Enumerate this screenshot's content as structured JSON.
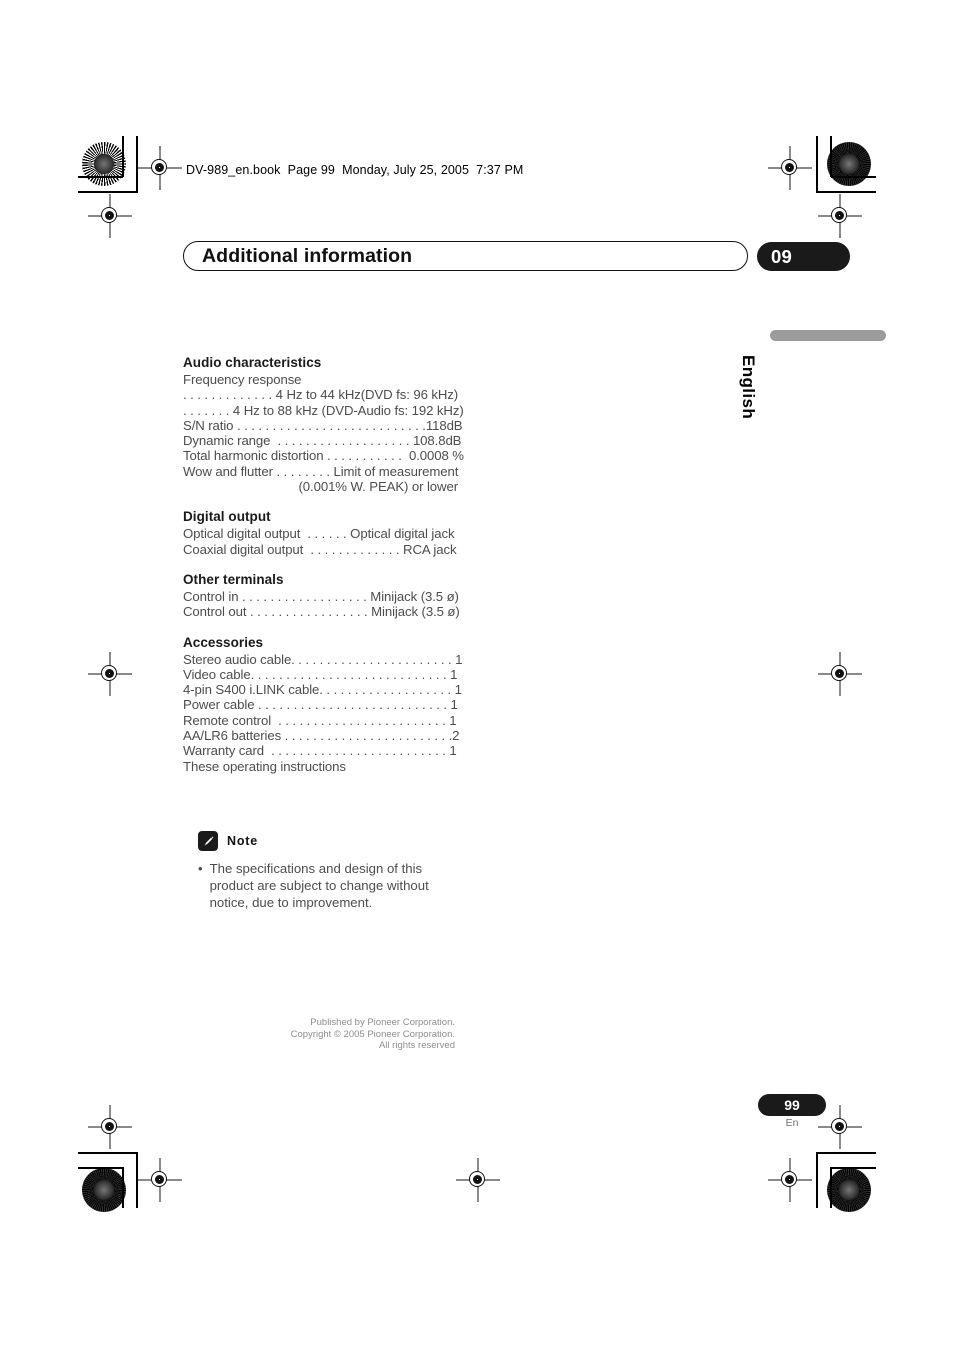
{
  "file_header": "DV-989_en.book  Page 99  Monday, July 25, 2005  7:37 PM",
  "chapter": {
    "title": "Additional information",
    "number": "09"
  },
  "language_tab": {
    "label": "English"
  },
  "spec_sections": [
    {
      "heading": "Audio characteristics",
      "lines": [
        {
          "text": "Frequency response",
          "align": "left"
        },
        {
          "text": ". . . . . . . . . . . . . 4 Hz to 44 kHz(DVD fs: 96 kHz)",
          "align": "right"
        },
        {
          "text": ". . . . . . . 4 Hz to 88 kHz (DVD-Audio fs: 192 kHz)",
          "align": "right"
        },
        {
          "text": "S/N ratio . . . . . . . . . . . . . . . . . . . . . . . . . . .118dB",
          "align": "left"
        },
        {
          "text": "Dynamic range  . . . . . . . . . . . . . . . . . . . 108.8dB",
          "align": "left"
        },
        {
          "text": "Total harmonic distortion . . . . . . . . . . .  0.0008 %",
          "align": "left"
        },
        {
          "text": "Wow and flutter . . . . . . . . Limit of measurement",
          "align": "left"
        },
        {
          "text": "(0.001% W. PEAK) or lower",
          "align": "right"
        }
      ]
    },
    {
      "heading": "Digital output",
      "lines": [
        {
          "text": "Optical digital output  . . . . . . Optical digital jack",
          "align": "left"
        },
        {
          "text": "Coaxial digital output  . . . . . . . . . . . . . RCA jack",
          "align": "left"
        }
      ]
    },
    {
      "heading": "Other terminals",
      "lines": [
        {
          "text": "Control in . . . . . . . . . . . . . . . . . . Minijack (3.5 ø)",
          "align": "left"
        },
        {
          "text": "Control out . . . . . . . . . . . . . . . . . Minijack (3.5 ø)",
          "align": "left"
        }
      ]
    },
    {
      "heading": "Accessories",
      "lines": [
        {
          "text": "Stereo audio cable. . . . . . . . . . . . . . . . . . . . . . . 1",
          "align": "left"
        },
        {
          "text": "Video cable. . . . . . . . . . . . . . . . . . . . . . . . . . . . 1",
          "align": "left"
        },
        {
          "text": "4-pin S400 i.LINK cable. . . . . . . . . . . . . . . . . . . 1",
          "align": "left"
        },
        {
          "text": "Power cable . . . . . . . . . . . . . . . . . . . . . . . . . . . 1",
          "align": "left"
        },
        {
          "text": "Remote control  . . . . . . . . . . . . . . . . . . . . . . . . 1",
          "align": "left"
        },
        {
          "text": "AA/LR6 batteries . . . . . . . . . . . . . . . . . . . . . . . .2",
          "align": "left"
        },
        {
          "text": "Warranty card  . . . . . . . . . . . . . . . . . . . . . . . . . 1",
          "align": "left"
        },
        {
          "text": "These operating instructions",
          "align": "left"
        }
      ]
    }
  ],
  "note": {
    "icon": "pencil-icon",
    "title": "Note",
    "bullet": "•",
    "body": "The specifications and design of this product are subject to change without notice, due to improvement."
  },
  "footer": {
    "line1": "Published by Pioneer Corporation.",
    "line2": "Copyright © 2005 Pioneer Corporation.",
    "line3": "All rights reserved"
  },
  "page_marker": {
    "number": "99",
    "language_code": "En"
  },
  "colors": {
    "body_text": "#4d4d4d",
    "heading_text": "#1a1a1a",
    "badge_fill": "#1a1a1a",
    "lang_bar": "#9c9c9e",
    "footer_text": "#8e8e8e"
  }
}
